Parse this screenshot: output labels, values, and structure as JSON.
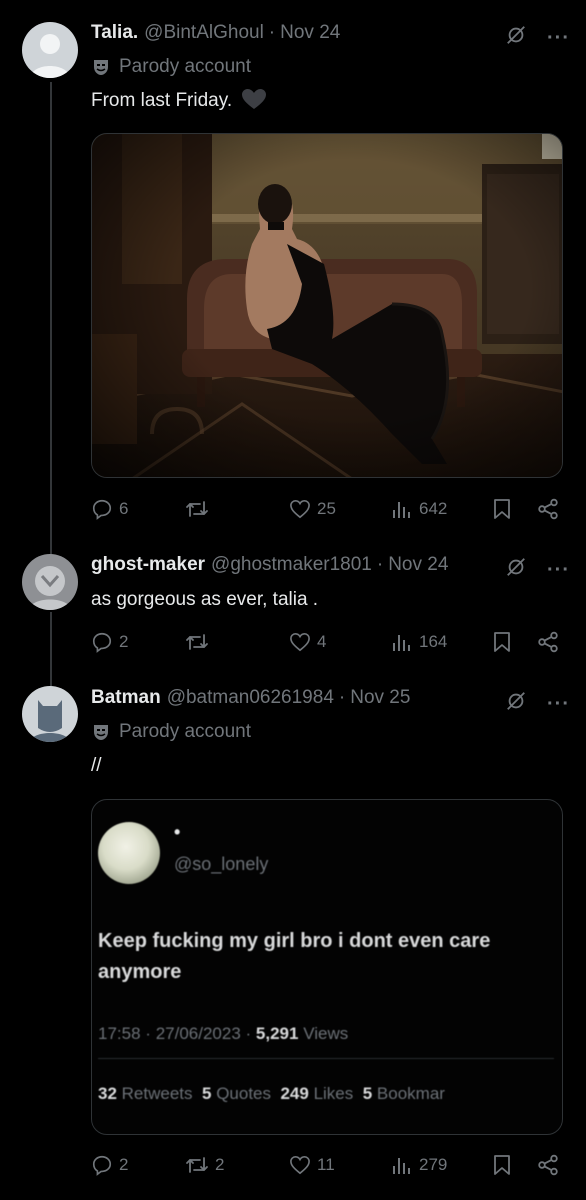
{
  "tweets": [
    {
      "name": "Talia.",
      "handle": "@BintAlGhoul",
      "date": "Nov 24",
      "parody_label": "Parody account",
      "text": "From last Friday.",
      "text_emoji": "black-heart",
      "stats": {
        "replies": "6",
        "retweets": "",
        "likes": "25",
        "views": "642"
      }
    },
    {
      "name": "ghost-maker",
      "handle": "@ghostmaker1801",
      "date": "Nov 24",
      "text": "as gorgeous as ever, talia .",
      "stats": {
        "replies": "2",
        "retweets": "",
        "likes": "4",
        "views": "164"
      }
    },
    {
      "name": "Batman",
      "handle": "@batman06261984",
      "date": "Nov 25",
      "parody_label": "Parody account",
      "text": "//",
      "stats": {
        "replies": "2",
        "retweets": "2",
        "likes": "11",
        "views": "279"
      },
      "quoted": {
        "name": "•",
        "handle": "@so_lonely",
        "text": "Keep fucking my girl bro i dont even care anymore",
        "time": "17:58",
        "date": "27/06/2023",
        "views_count": "5,291",
        "views_label": "Views",
        "retweets_count": "32",
        "retweets_label": "Retweets",
        "quotes_count": "5",
        "quotes_label": "Quotes",
        "likes_count": "249",
        "likes_label": "Likes",
        "bookmarks_count": "5",
        "bookmarks_label": "Bookmar"
      }
    }
  ],
  "sep": "·",
  "more": "···",
  "colors": {
    "bg": "#000000",
    "text": "#e7e9ea",
    "muted": "#71767b",
    "border": "#2f3336"
  },
  "icons": [
    "grok-icon",
    "more-icon",
    "parody-mask-icon",
    "reply-icon",
    "retweet-icon",
    "like-icon",
    "views-icon",
    "bookmark-icon",
    "share-icon",
    "black-heart-emoji"
  ]
}
